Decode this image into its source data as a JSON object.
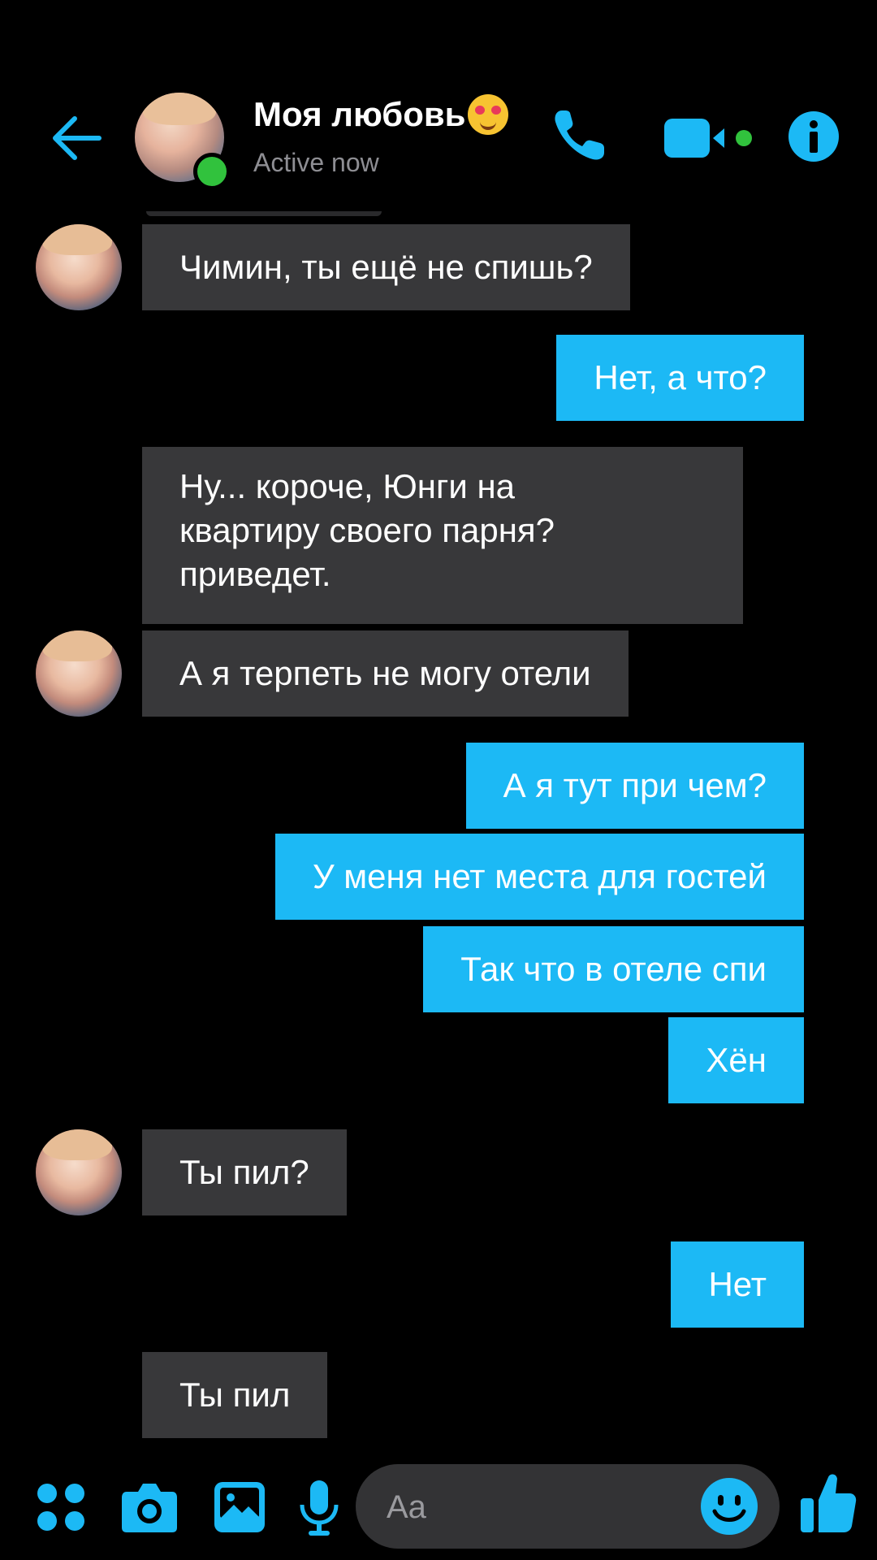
{
  "header": {
    "contact_name": "Моя любовь",
    "status": "Active now",
    "icons": {
      "back": "back-arrow-icon",
      "call": "phone-icon",
      "video": "video-camera-icon",
      "info": "info-icon"
    }
  },
  "messages": [
    {
      "side": "received",
      "text": "Чимин, ты ещё не спишь?"
    },
    {
      "side": "sent",
      "text": "Нет, а что?"
    },
    {
      "side": "received",
      "text": "Ну... короче, Юнги на\nквартиру своего парня?\nприведет."
    },
    {
      "side": "received",
      "text": "А я терпеть не могу отели"
    },
    {
      "side": "sent",
      "text": "А я тут при чем?"
    },
    {
      "side": "sent",
      "text": "У меня нет места для гостей"
    },
    {
      "side": "sent",
      "text": "Так что в отеле спи"
    },
    {
      "side": "sent",
      "text": "Хён"
    },
    {
      "side": "received",
      "text": "Ты пил?"
    },
    {
      "side": "sent",
      "text": "Нет"
    },
    {
      "side": "received",
      "text": "Ты пил"
    }
  ],
  "composer": {
    "placeholder": "Aa",
    "icons": [
      "apps-icon",
      "camera-icon",
      "gallery-icon",
      "microphone-icon",
      "emoji-icon",
      "thumbs-up-icon"
    ]
  },
  "colors": {
    "accent": "#1cb9f5",
    "received_bubble": "#38383a",
    "online": "#31c23d",
    "background": "#000000"
  }
}
